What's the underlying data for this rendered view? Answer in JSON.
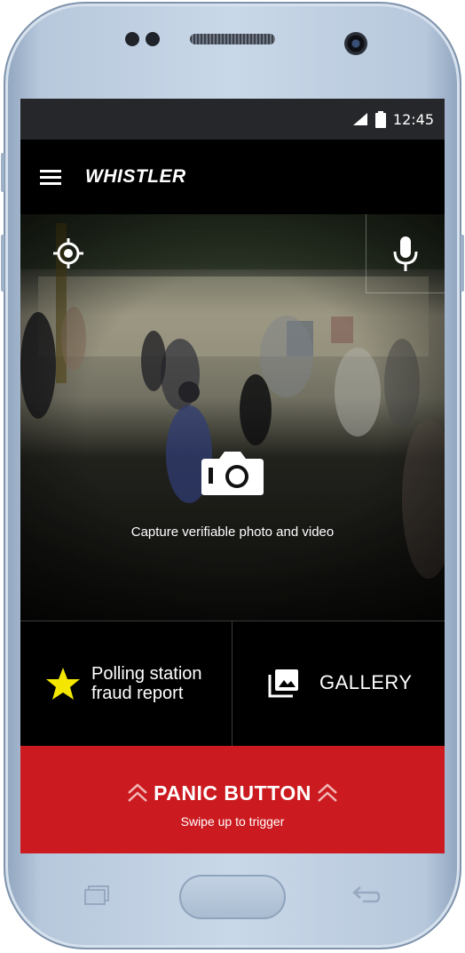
{
  "status_bar": {
    "time": "12:45",
    "signal_icon": "signal-icon",
    "battery_icon": "battery-icon"
  },
  "app_bar": {
    "title": "WHISTLER",
    "menu_icon": "hamburger-menu-icon"
  },
  "camera": {
    "location_icon": "gps-target-icon",
    "mic_icon": "microphone-icon",
    "capture_icon": "camera-icon",
    "capture_label": "Capture verifiable photo and video"
  },
  "tiles": {
    "report": {
      "icon": "star-icon",
      "line1": "Polling station",
      "line2": "fraud report"
    },
    "gallery": {
      "icon": "gallery-icon",
      "label": "GALLERY"
    }
  },
  "panic": {
    "title": "PANIC BUTTON",
    "subtitle": "Swipe up to trigger",
    "icon": "double-chevron-up-icon"
  },
  "colors": {
    "panic_red": "#cc1b20",
    "star_yellow": "#f4e600",
    "device_blue": "#b7c8dc"
  }
}
